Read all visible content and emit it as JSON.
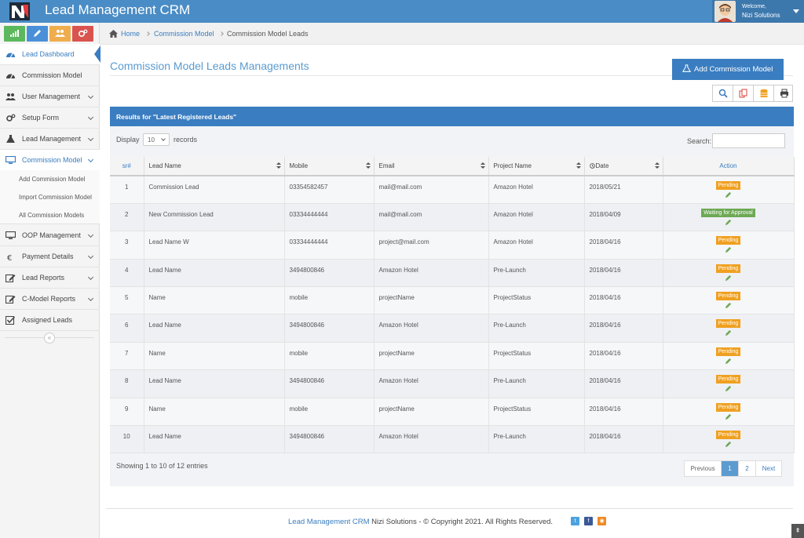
{
  "app": {
    "title": "Lead Management CRM"
  },
  "user": {
    "welcome": "Welcome,",
    "name": "Nizi Solutions"
  },
  "sidebar": {
    "items": [
      {
        "label": "Lead Dashboard",
        "icon": "dashboard-icon"
      },
      {
        "label": "Commission Model",
        "icon": "dashboard-icon"
      },
      {
        "label": "User Management",
        "icon": "users-icon"
      },
      {
        "label": "Setup Form",
        "icon": "gears-icon"
      },
      {
        "label": "Lead Management",
        "icon": "flask-icon"
      },
      {
        "label": "Commission Model",
        "icon": "monitor-icon"
      },
      {
        "label": "OOP Management",
        "icon": "monitor-icon"
      },
      {
        "label": "Payment Details",
        "icon": "euro-icon"
      },
      {
        "label": "Lead Reports",
        "icon": "edit-icon"
      },
      {
        "label": "C-Model Reports",
        "icon": "edit-icon"
      },
      {
        "label": "Assigned Leads",
        "icon": "check-square-icon"
      }
    ],
    "subitems": [
      {
        "label": "Add Commission Model"
      },
      {
        "label": "Import Commission Model"
      },
      {
        "label": "All Commission Models"
      }
    ],
    "collapse": "«"
  },
  "breadcrumb": {
    "home": "Home",
    "parent": "Commission Model",
    "current": "Commission Model Leads"
  },
  "page": {
    "title": "Commission Model Leads Managements",
    "add_button": "Add Commission Model"
  },
  "panel": {
    "heading": "Results for \"Latest Registered Leads\"",
    "display_label": "Display",
    "display_value": "10",
    "records_label": "records",
    "search_label": "Search:"
  },
  "table": {
    "headers": [
      "sr#",
      "Lead Name",
      "Mobile",
      "Email",
      "Project Name",
      "Date",
      "Action"
    ],
    "rows": [
      {
        "sr": "1",
        "name": "Commission Lead",
        "mobile": "03354582457",
        "email": "mail@mail.com",
        "project": "Amazon Hotel",
        "date": "2018/05/21",
        "status": "Pending"
      },
      {
        "sr": "2",
        "name": "New Commission Lead",
        "mobile": "03334444444",
        "email": "mail@mail.com",
        "project": "Amazon Hotel",
        "date": "2018/04/09",
        "status": "Waiting for Approval"
      },
      {
        "sr": "3",
        "name": "Lead Name W",
        "mobile": "03334444444",
        "email": "project@mail.com",
        "project": "Amazon Hotel",
        "date": "2018/04/16",
        "status": "Pending"
      },
      {
        "sr": "4",
        "name": "Lead Name",
        "mobile": "3494800846",
        "email": "Amazon Hotel",
        "project": "Pre-Launch",
        "date": "2018/04/16",
        "status": "Pending"
      },
      {
        "sr": "5",
        "name": "Name",
        "mobile": "mobile",
        "email": "projectName",
        "project": "ProjectStatus",
        "date": "2018/04/16",
        "status": "Pending"
      },
      {
        "sr": "6",
        "name": "Lead Name",
        "mobile": "3494800846",
        "email": "Amazon Hotel",
        "project": "Pre-Launch",
        "date": "2018/04/16",
        "status": "Pending"
      },
      {
        "sr": "7",
        "name": "Name",
        "mobile": "mobile",
        "email": "projectName",
        "project": "ProjectStatus",
        "date": "2018/04/16",
        "status": "Pending"
      },
      {
        "sr": "8",
        "name": "Lead Name",
        "mobile": "3494800846",
        "email": "Amazon Hotel",
        "project": "Pre-Launch",
        "date": "2018/04/16",
        "status": "Pending"
      },
      {
        "sr": "9",
        "name": "Name",
        "mobile": "mobile",
        "email": "projectName",
        "project": "ProjectStatus",
        "date": "2018/04/16",
        "status": "Pending"
      },
      {
        "sr": "10",
        "name": "Lead Name",
        "mobile": "3494800846",
        "email": "Amazon Hotel",
        "project": "Pre-Launch",
        "date": "2018/04/16",
        "status": "Pending"
      }
    ],
    "info": "Showing 1 to 10 of 12 entries"
  },
  "pagination": {
    "previous": "Previous",
    "pages": [
      "1",
      "2"
    ],
    "current": "1",
    "next": "Next"
  },
  "footer": {
    "brand": "Lead Management CRM",
    "text": " Nizi Solutions - © Copyright 2021. All Rights Reserved."
  },
  "colors": {
    "primary": "#3a7dc0",
    "topbar": "#4a8cc5",
    "pending": "#f0a020",
    "waiting": "#6ea955",
    "shortcut_green": "#5cb85c",
    "shortcut_blue": "#4a90d9",
    "shortcut_orange": "#f0ad4e",
    "shortcut_red": "#d9534f"
  }
}
